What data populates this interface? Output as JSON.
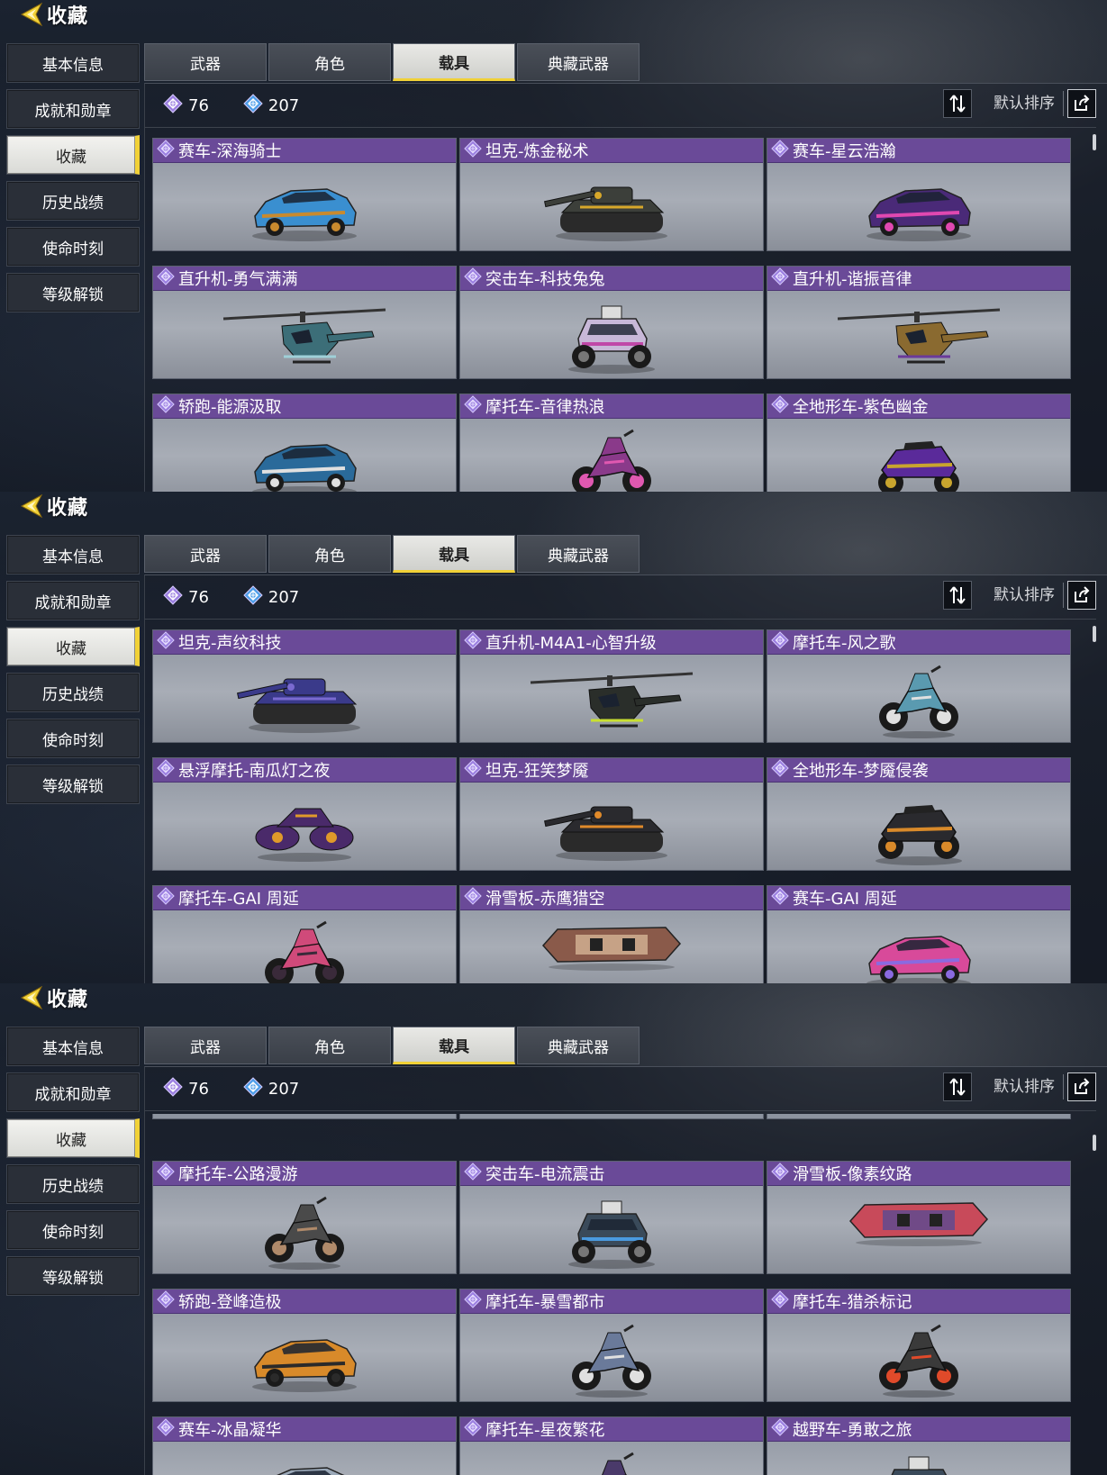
{
  "header": {
    "title": "收藏"
  },
  "sidebar": {
    "items": [
      "基本信息",
      "成就和勋章",
      "收藏",
      "历史战绩",
      "使命时刻",
      "等级解锁"
    ],
    "active_index": 2
  },
  "tabs": {
    "items": [
      "武器",
      "角色",
      "载具",
      "典藏武器"
    ],
    "active_index": 2
  },
  "stats": {
    "purple_count": "76",
    "blue_count": "207"
  },
  "sort": {
    "label": "默认排序"
  },
  "colors": {
    "accent_yellow": "#f1d137",
    "card_header_purple": "#6a4a98",
    "purple_gem": "#9b7fe0",
    "blue_gem": "#4d9ee8"
  },
  "panels": [
    {
      "scroll_fraction": 0.0,
      "cards": [
        {
          "name": "赛车-深海骑士",
          "vehicle_type": "car",
          "color": "#3a8fd0",
          "accent": "#c98a2e"
        },
        {
          "name": "坦克-炼金秘术",
          "vehicle_type": "tank",
          "color": "#3c3f3a",
          "accent": "#d7a72a"
        },
        {
          "name": "赛车-星云浩瀚",
          "vehicle_type": "car",
          "color": "#4a2a78",
          "accent": "#e048b0"
        },
        {
          "name": "直升机-勇气满满",
          "vehicle_type": "heli",
          "color": "#3c6e78",
          "accent": "#9fd0d8"
        },
        {
          "name": "突击车-科技兔兔",
          "vehicle_type": "buggy",
          "color": "#c8b8d8",
          "accent": "#c048a8"
        },
        {
          "name": "直升机-谐振音律",
          "vehicle_type": "heli",
          "color": "#8a6a30",
          "accent": "#6a3a9a"
        },
        {
          "name": "轿跑-能源汲取",
          "vehicle_type": "car",
          "color": "#2a6a9a",
          "accent": "#e0e0e0"
        },
        {
          "name": "摩托车-音律热浪",
          "vehicle_type": "moto",
          "color": "#8a3a8a",
          "accent": "#e058b0"
        },
        {
          "name": "全地形车-紫色幽金",
          "vehicle_type": "atv",
          "color": "#5a2a9a",
          "accent": "#c9a52e"
        }
      ]
    },
    {
      "scroll_fraction": 0.0,
      "cards": [
        {
          "name": "坦克-声纹科技",
          "vehicle_type": "tank",
          "color": "#3a3a8a",
          "accent": "#7a6ad0"
        },
        {
          "name": "直升机-M4A1-心智升级",
          "vehicle_type": "heli",
          "color": "#2a2e2a",
          "accent": "#c9e030"
        },
        {
          "name": "摩托车-风之歌",
          "vehicle_type": "moto",
          "color": "#5a9ab0",
          "accent": "#e0e0e0"
        },
        {
          "name": "悬浮摩托-南瓜灯之夜",
          "vehicle_type": "hover",
          "color": "#4a2a6a",
          "accent": "#e09a2a"
        },
        {
          "name": "坦克-狂笑梦魇",
          "vehicle_type": "tank",
          "color": "#2a2a2e",
          "accent": "#e08a2a"
        },
        {
          "name": "全地形车-梦魇侵袭",
          "vehicle_type": "atv",
          "color": "#2a2a2e",
          "accent": "#d98a2a"
        },
        {
          "name": "摩托车-GAI 周延",
          "vehicle_type": "moto",
          "color": "#d04a7a",
          "accent": "#3a2a3a"
        },
        {
          "name": "滑雪板-赤鹰猎空",
          "vehicle_type": "board",
          "color": "#8a5a4a",
          "accent": "#e0c0a0"
        },
        {
          "name": "赛车-GAI 周延",
          "vehicle_type": "car",
          "color": "#d84a9a",
          "accent": "#8a6ae0"
        }
      ]
    },
    {
      "scroll_fraction": 0.05,
      "cards": [
        {
          "name": "摩托车-公路漫游",
          "vehicle_type": "moto",
          "color": "#4a4a4a",
          "accent": "#b08a6a"
        },
        {
          "name": "突击车-电流震击",
          "vehicle_type": "buggy",
          "color": "#3a4a5a",
          "accent": "#4a9ae0"
        },
        {
          "name": "滑雪板-像素纹路",
          "vehicle_type": "board",
          "color": "#c84a5a",
          "accent": "#4a4a9a"
        },
        {
          "name": "轿跑-登峰造极",
          "vehicle_type": "car",
          "color": "#d88a2a",
          "accent": "#2a2a2a"
        },
        {
          "name": "摩托车-暴雪都市",
          "vehicle_type": "moto",
          "color": "#6a7a9a",
          "accent": "#e0e0e0"
        },
        {
          "name": "摩托车-猎杀标记",
          "vehicle_type": "moto",
          "color": "#3a3a3a",
          "accent": "#e04a2a"
        },
        {
          "name": "赛车-冰晶凝华",
          "vehicle_type": "car",
          "color": "#9aa8b8",
          "accent": "#d0d8e0"
        },
        {
          "name": "摩托车-星夜繁花",
          "vehicle_type": "moto",
          "color": "#4a3a6a",
          "accent": "#c06ad8"
        },
        {
          "name": "越野车-勇敢之旅",
          "vehicle_type": "buggy",
          "color": "#3a4a5a",
          "accent": "#d84a4a"
        }
      ]
    }
  ]
}
